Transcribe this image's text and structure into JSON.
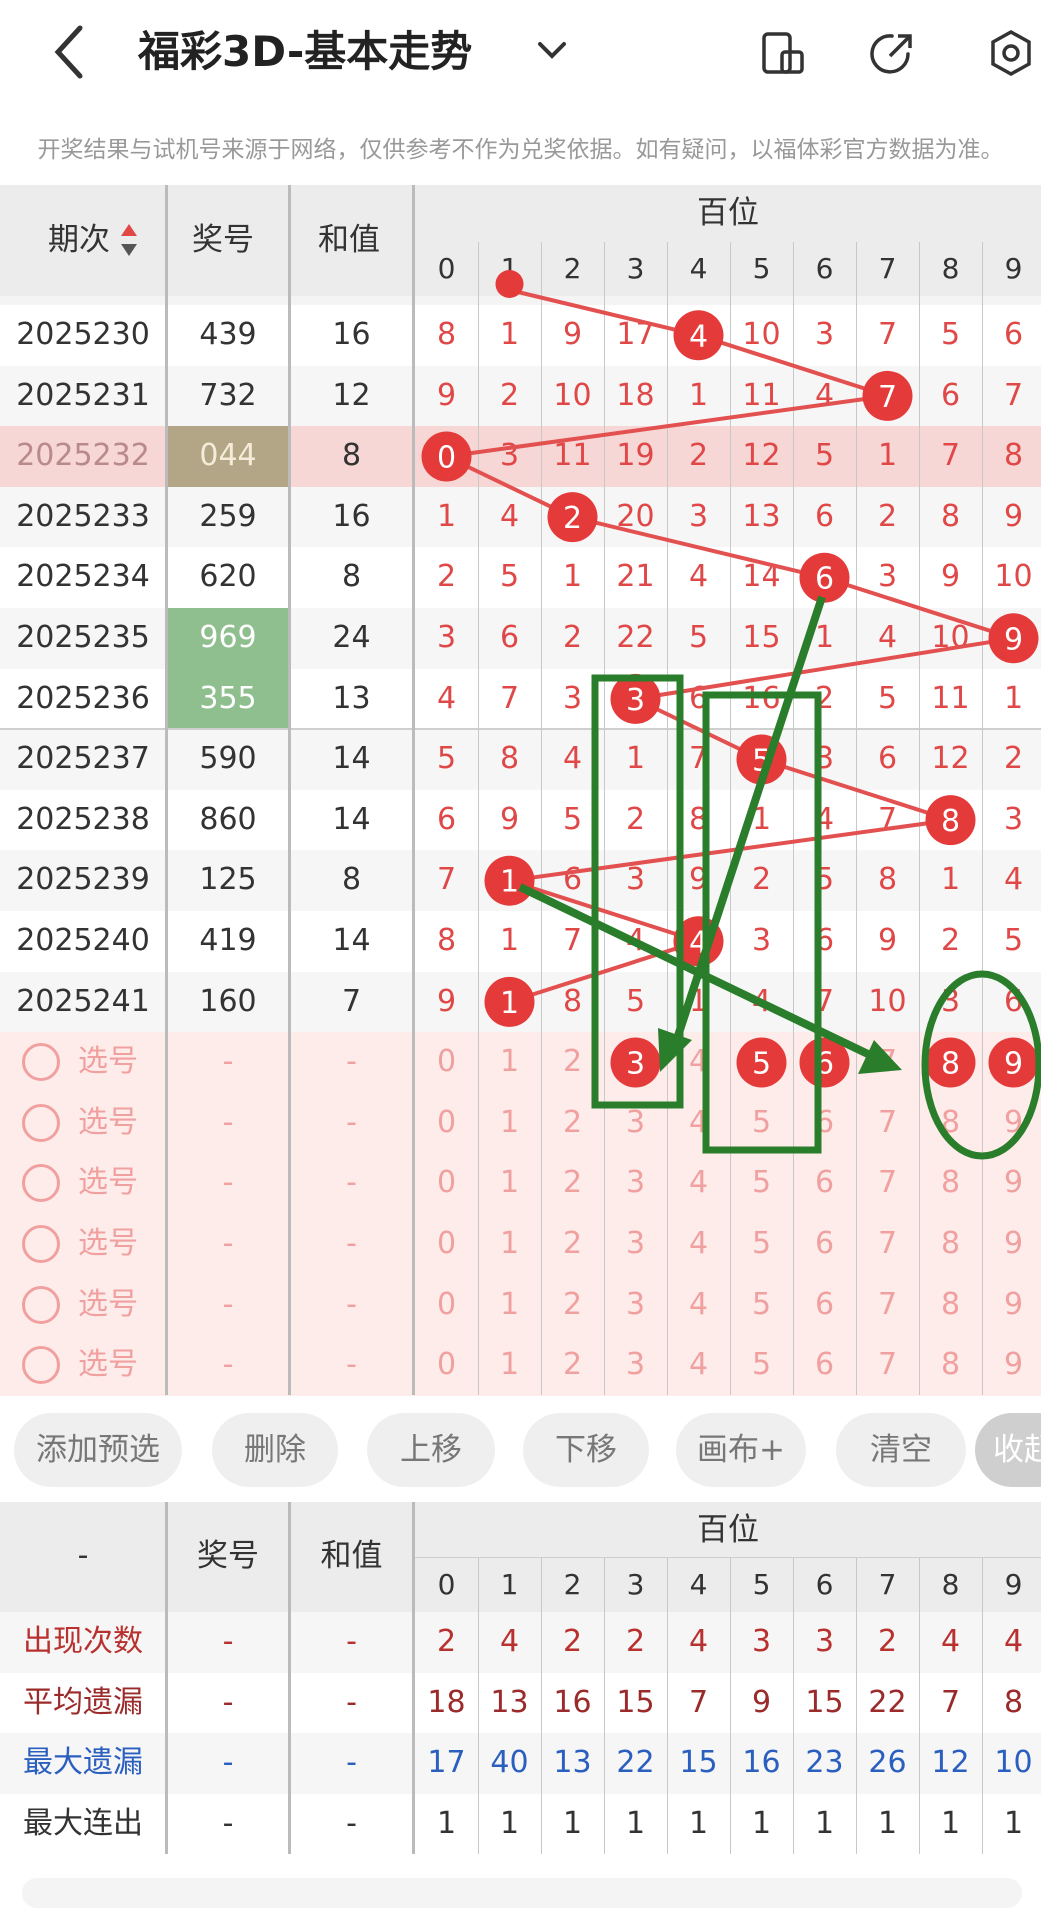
{
  "header": {
    "title": "福彩3D-基本走势",
    "notice": "开奖结果与试机号来源于网络，仅供参考不作为兑奖依据。如有疑问，以福体彩官方数据为准。",
    "icons": [
      "back-icon",
      "chevron-down-icon",
      "phone-icon",
      "share-icon",
      "settings-icon"
    ]
  },
  "table": {
    "col_period": "期次",
    "col_number": "奖号",
    "col_sum": "和值",
    "group_label": "百位",
    "digits": [
      "0",
      "1",
      "2",
      "3",
      "4",
      "5",
      "6",
      "7",
      "8",
      "9"
    ],
    "rows": [
      {
        "period": "2025230",
        "number": "439",
        "sum": "16",
        "hundred": 4,
        "cells": [
          "8",
          "1",
          "9",
          "17",
          "4",
          "10",
          "3",
          "7",
          "5",
          "6"
        ]
      },
      {
        "period": "2025231",
        "number": "732",
        "sum": "12",
        "hundred": 7,
        "cells": [
          "9",
          "2",
          "10",
          "18",
          "1",
          "11",
          "4",
          "7",
          "6",
          "7"
        ]
      },
      {
        "period": "2025232",
        "number": "044",
        "sum": "8",
        "hundred": 0,
        "cells": [
          "0",
          "3",
          "11",
          "19",
          "2",
          "12",
          "5",
          "1",
          "7",
          "8"
        ]
      },
      {
        "period": "2025233",
        "number": "259",
        "sum": "16",
        "hundred": 2,
        "cells": [
          "1",
          "4",
          "2",
          "20",
          "3",
          "13",
          "6",
          "2",
          "8",
          "9"
        ]
      },
      {
        "period": "2025234",
        "number": "620",
        "sum": "8",
        "hundred": 6,
        "cells": [
          "2",
          "5",
          "1",
          "21",
          "4",
          "14",
          "6",
          "3",
          "9",
          "10"
        ]
      },
      {
        "period": "2025235",
        "number": "969",
        "sum": "24",
        "hundred": 9,
        "cells": [
          "3",
          "6",
          "2",
          "22",
          "5",
          "15",
          "1",
          "4",
          "10",
          "9"
        ]
      },
      {
        "period": "2025236",
        "number": "355",
        "sum": "13",
        "hundred": 3,
        "cells": [
          "4",
          "7",
          "3",
          "3",
          "6",
          "16",
          "2",
          "5",
          "11",
          "1"
        ]
      },
      {
        "period": "2025237",
        "number": "590",
        "sum": "14",
        "hundred": 5,
        "cells": [
          "5",
          "8",
          "4",
          "1",
          "7",
          "5",
          "3",
          "6",
          "12",
          "2"
        ]
      },
      {
        "period": "2025238",
        "number": "860",
        "sum": "14",
        "hundred": 8,
        "cells": [
          "6",
          "9",
          "5",
          "2",
          "8",
          "1",
          "4",
          "7",
          "8",
          "3"
        ]
      },
      {
        "period": "2025239",
        "number": "125",
        "sum": "8",
        "hundred": 1,
        "cells": [
          "7",
          "1",
          "6",
          "3",
          "9",
          "2",
          "5",
          "8",
          "1",
          "4"
        ]
      },
      {
        "period": "2025240",
        "number": "419",
        "sum": "14",
        "hundred": 4,
        "cells": [
          "8",
          "1",
          "7",
          "4",
          "4",
          "3",
          "6",
          "9",
          "2",
          "5"
        ]
      },
      {
        "period": "2025241",
        "number": "160",
        "sum": "7",
        "hundred": 1,
        "cells": [
          "9",
          "1",
          "8",
          "5",
          "1",
          "4",
          "7",
          "10",
          "3",
          "6"
        ]
      }
    ],
    "pick_label": "选号",
    "pick_dash": "-",
    "pick_rows": 6,
    "pick_selected": [
      3,
      5,
      6,
      8,
      9
    ]
  },
  "buttons": [
    "添加预选",
    "删除",
    "上移",
    "下移",
    "画布+",
    "清空",
    "收起"
  ],
  "stats": {
    "col_first": "-",
    "col_number": "奖号",
    "col_sum": "和值",
    "group_label": "百位",
    "dash": "-",
    "rows": [
      {
        "label": "出现次数",
        "color": "#b8312f",
        "values": [
          "2",
          "4",
          "2",
          "2",
          "4",
          "3",
          "3",
          "2",
          "4",
          "4"
        ]
      },
      {
        "label": "平均遗漏",
        "color": "#9b2a2a",
        "values": [
          "18",
          "13",
          "16",
          "15",
          "7",
          "9",
          "15",
          "22",
          "7",
          "8"
        ]
      },
      {
        "label": "最大遗漏",
        "color": "#2b5fbf",
        "values": [
          "17",
          "40",
          "13",
          "22",
          "15",
          "16",
          "23",
          "26",
          "12",
          "10"
        ]
      },
      {
        "label": "最大连出",
        "color": "#333333",
        "values": [
          "1",
          "1",
          "1",
          "1",
          "1",
          "1",
          "1",
          "1",
          "1",
          "1"
        ]
      }
    ]
  },
  "colors": {
    "ball": "#e53a3a",
    "annotation": "#2a7d2a",
    "highlight_row": "#f7d6d6",
    "green_cell": "#8fbf8f"
  }
}
